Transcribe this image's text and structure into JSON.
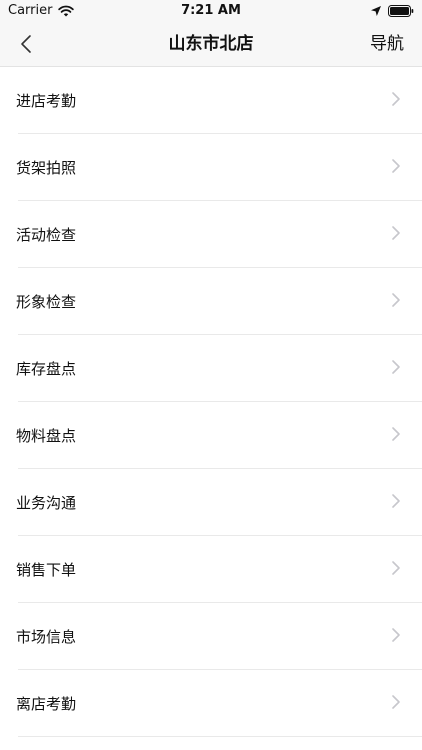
{
  "status_bar": {
    "carrier": "Carrier",
    "time": "7:21 AM",
    "icons": [
      "wifi-icon",
      "location-arrow-icon",
      "battery-icon"
    ]
  },
  "nav": {
    "title": "山东市北店",
    "right_action": "导航",
    "back_icon": "chevron-left-icon"
  },
  "menu": {
    "items": [
      {
        "label": "进店考勤"
      },
      {
        "label": "货架拍照"
      },
      {
        "label": "活动检查"
      },
      {
        "label": "形象检查"
      },
      {
        "label": "库存盘点"
      },
      {
        "label": "物料盘点"
      },
      {
        "label": "业务沟通"
      },
      {
        "label": "销售下单"
      },
      {
        "label": "市场信息"
      },
      {
        "label": "离店考勤"
      }
    ],
    "chevron_icon": "chevron-right-icon"
  },
  "colors": {
    "bar_background": "#f7f7f7",
    "chevron": "#c7c7cc",
    "separator": "#e9e9e9"
  }
}
